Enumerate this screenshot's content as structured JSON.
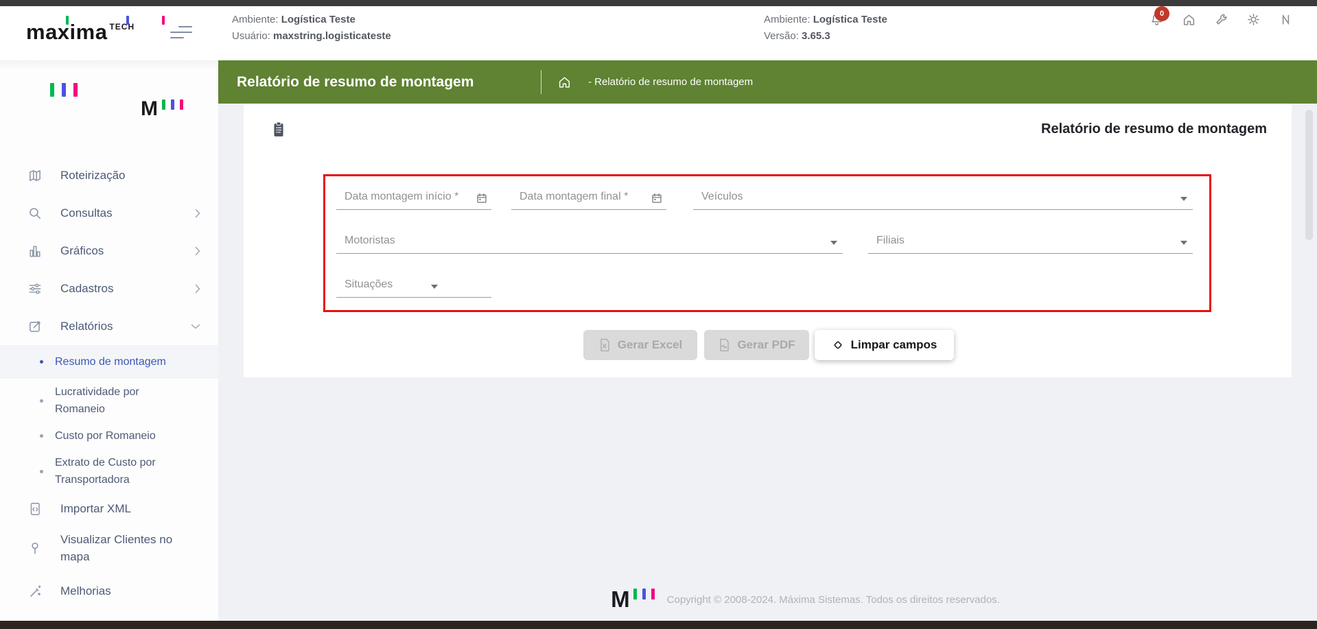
{
  "header": {
    "brand": "maxima",
    "brand_sub": "TECH",
    "env": {
      "label": "Ambiente:",
      "value": "Logística Teste"
    },
    "user": {
      "label": "Usuário:",
      "value": "maxstring.logisticateste"
    },
    "env2": {
      "label": "Ambiente:",
      "value": "Logística Teste"
    },
    "version": {
      "label": "Versão:",
      "value": "3.65.3"
    },
    "notification_badge": "0"
  },
  "topbar": {
    "title": "Relatório de resumo de montagem",
    "breadcrumb": "- Relatório de resumo de montagem"
  },
  "sidebar": {
    "logo_m": "M",
    "items": [
      {
        "label": "Roteirização"
      },
      {
        "label": "Consultas"
      },
      {
        "label": "Gráficos"
      },
      {
        "label": "Cadastros"
      },
      {
        "label": "Relatórios"
      }
    ],
    "report_submenu": [
      {
        "label": "Resumo de montagem",
        "active": true
      },
      {
        "label": "Lucratividade por Romaneio",
        "active": false
      },
      {
        "label": "Custo por Romaneio",
        "active": false
      },
      {
        "label": "Extrato de Custo por Transportadora",
        "active": false
      }
    ],
    "bottom_items": [
      {
        "label": "Importar XML"
      },
      {
        "label": "Visualizar Clientes no mapa"
      },
      {
        "label": "Melhorias"
      }
    ]
  },
  "main": {
    "card_title": "Relatório de resumo de montagem",
    "fields": {
      "date_start": {
        "label": "Data montagem início *"
      },
      "date_end": {
        "label": "Data montagem final *"
      },
      "vehicles": {
        "label": "Veículos"
      },
      "drivers": {
        "label": "Motoristas"
      },
      "branches": {
        "label": "Filiais"
      },
      "situations": {
        "label": "Situações"
      }
    },
    "buttons": {
      "excel": {
        "label": "Gerar Excel",
        "enabled": false
      },
      "pdf": {
        "label": "Gerar PDF",
        "enabled": false
      },
      "clear": {
        "label": "Limpar campos",
        "enabled": true
      }
    }
  },
  "footer": {
    "logo": "M",
    "copyright": "Copyright © 2008-2024. Máxima Sistemas. Todos os direitos reservados."
  },
  "colors": {
    "topbar_green": "#5f8233",
    "highlight_red": "#e8100f",
    "active_blue": "#3a57b8",
    "badge_red": "#c0392b",
    "brand_green": "#00b74f",
    "brand_blue": "#4c52e0",
    "brand_pink": "#f5087c"
  }
}
